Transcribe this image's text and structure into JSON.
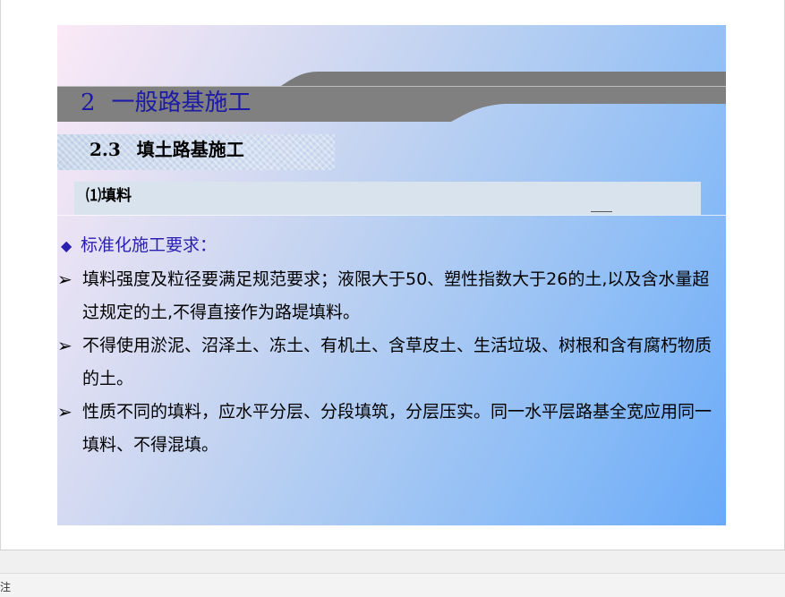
{
  "slide": {
    "title_number": "2",
    "title_text": "一般路基施工",
    "section_number": "2.3",
    "section_text": "填土路基施工",
    "subsection_text": "⑴填料",
    "requirements_heading": "标准化施工要求：",
    "bullets": [
      {
        "text": "填料强度及粒径要满足规范要求；液限大于50、塑性指数大于26的土,以及含水量超过规定的土,不得直接作为路堤填料。"
      },
      {
        "text": "不得使用淤泥、沼泽土、冻土、有机土、含草皮土、生活垃圾、树根和含有腐朽物质的土。"
      },
      {
        "text": "性质不同的填料，应水平分层、分段填筑，分层压实。同一水平层路基全宽应用同一填料、不得混填。"
      }
    ],
    "colors": {
      "title": "#1c1aa6",
      "heading": "#2a1fb0",
      "band": "#808080"
    }
  },
  "notes_bar": {
    "label": "注"
  }
}
